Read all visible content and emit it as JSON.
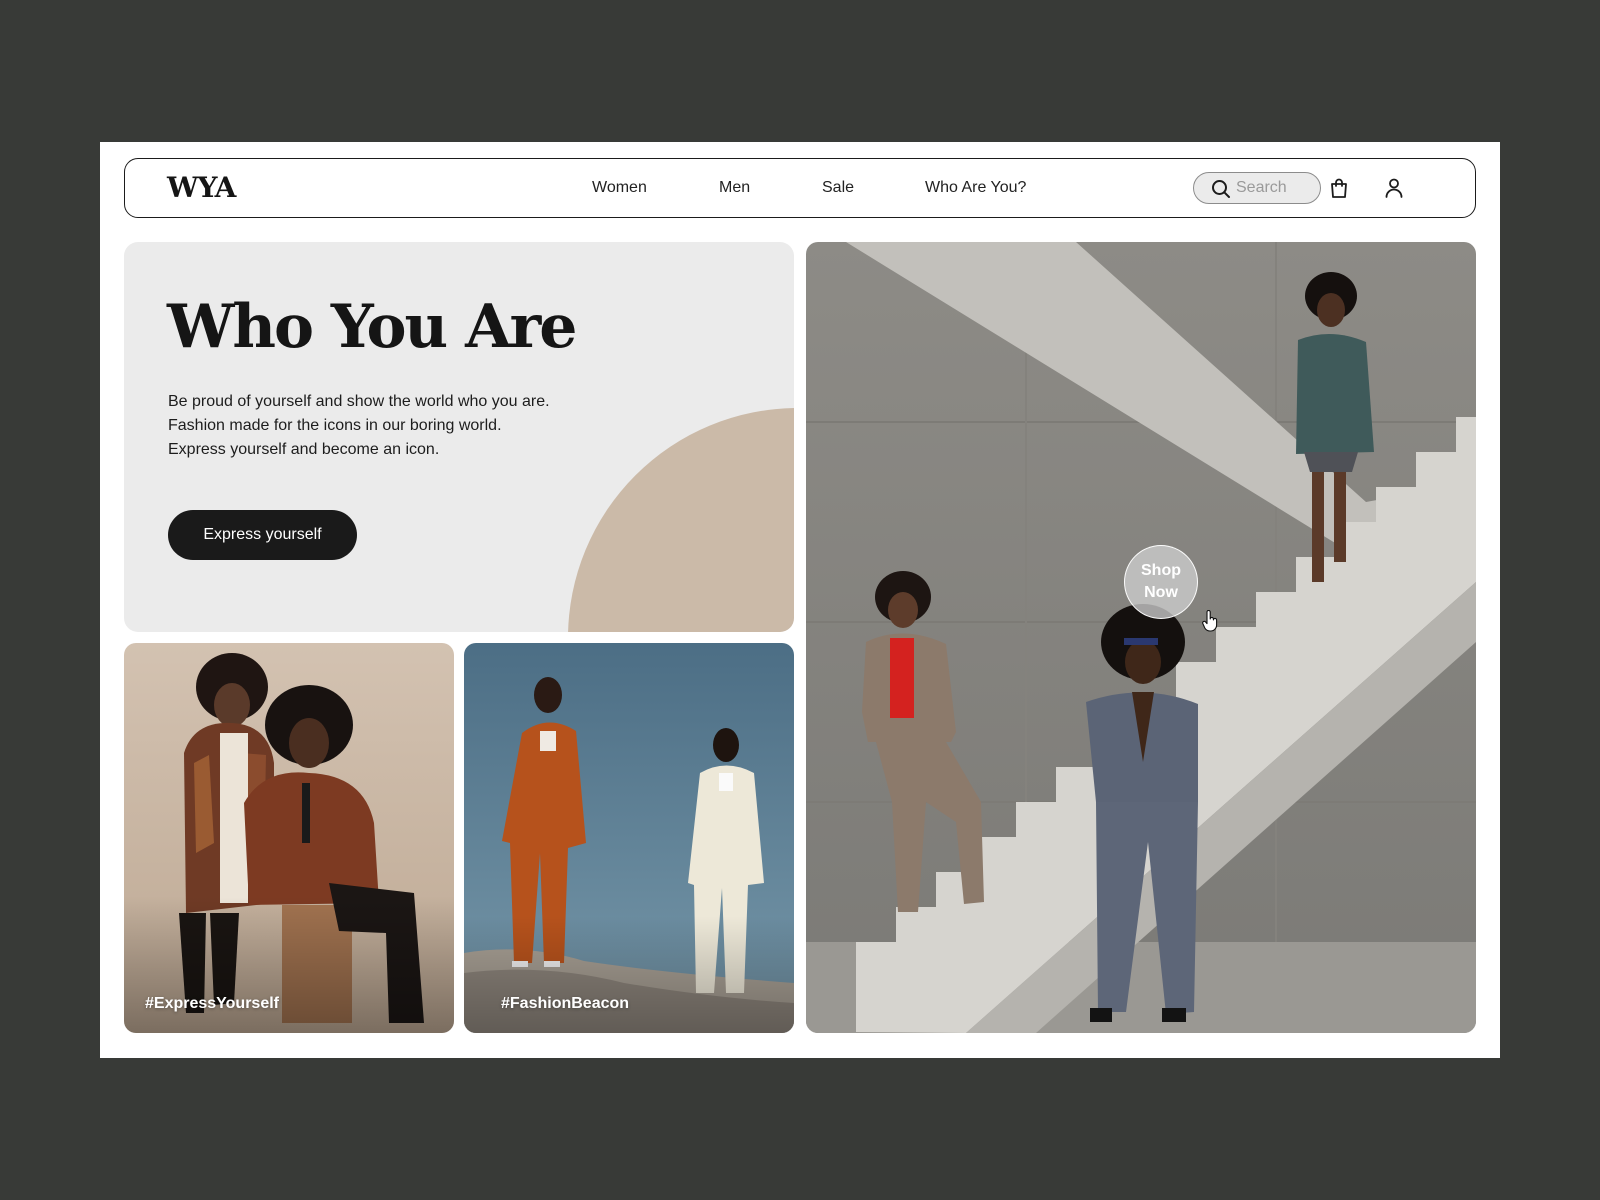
{
  "brand": {
    "logo": "WYA"
  },
  "nav": {
    "links": [
      "Women",
      "Men",
      "Sale",
      "Who Are You?"
    ],
    "search_placeholder": "Search",
    "icons": [
      "search-icon",
      "shopping-bag-icon",
      "user-icon"
    ]
  },
  "hero": {
    "title": "Who You Are",
    "lines": [
      "Be proud of yourself and show the world who you are.",
      "Fashion made for the icons in our boring world.",
      "Express yourself and become an icon."
    ],
    "cta_label": "Express yourself",
    "accent_color": "#cbbaa8"
  },
  "cards": [
    {
      "hashtag": "#ExpressYourself"
    },
    {
      "hashtag": "#FashionBeacon"
    }
  ],
  "feature": {
    "shop_now_line1": "Shop",
    "shop_now_line2": "Now"
  },
  "colors": {
    "backdrop": "#383a37",
    "page": "#ffffff",
    "dark": "#1a1a1a",
    "hero_bg": "#ebebeb"
  }
}
